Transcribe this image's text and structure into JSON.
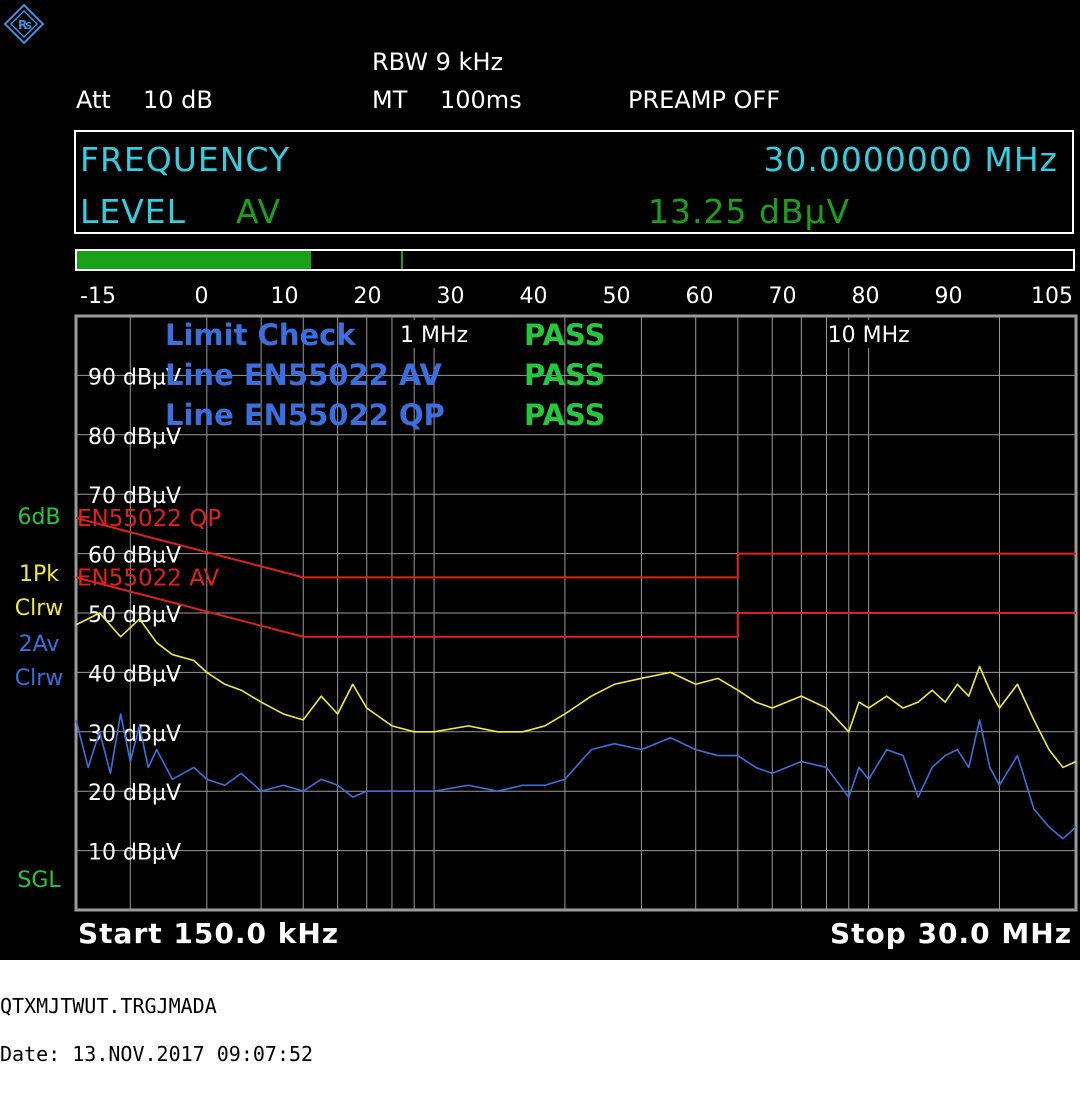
{
  "header": {
    "rbw": "RBW 9 kHz",
    "att_label": "Att",
    "att_value": "10 dB",
    "mt_label": "MT",
    "mt_value": "100ms",
    "preamp": "PREAMP OFF"
  },
  "readout": {
    "frequency_label": "FREQUENCY",
    "frequency_value": "30.0000000 MHz",
    "level_label": "LEVEL",
    "level_detector": "AV",
    "level_value": "13.25 dBµV"
  },
  "bargraph": {
    "scale_labels": [
      "-15",
      "0",
      "10",
      "20",
      "30",
      "40",
      "50",
      "60",
      "70",
      "80",
      "90",
      "105"
    ],
    "range": [
      -15,
      105
    ],
    "fill_value": 13.25,
    "marker_value": 24
  },
  "side_labels": {
    "offset": "6dB",
    "trace1_detector": "1Pk",
    "trace1_mode": "Clrw",
    "trace2_detector": "2Av",
    "trace2_mode": "Clrw",
    "sweep_mode": "SGL"
  },
  "limit_check": {
    "rows": [
      {
        "label": "Limit Check",
        "result": "PASS"
      },
      {
        "label": "Line EN55022 AV",
        "result": "PASS"
      },
      {
        "label": "Line EN55022 QP",
        "result": "PASS"
      }
    ]
  },
  "footer": {
    "start": "Start 150.0 kHz",
    "stop": "Stop 30.0 MHz"
  },
  "print_info": {
    "code": "QTXMJTWUT.TRGJMADA",
    "date": "Date: 13.NOV.2017  09:07:52"
  },
  "colors": {
    "background": "#000000",
    "grid": "#9a9a9a",
    "cyan": "#33cfe0",
    "green": "#1aa11a",
    "bright_green": "#22c93a",
    "blue_text": "#3a6fe0",
    "trace_pk": "#f0ea3c",
    "trace_av": "#3f6fdc",
    "limit": "#e0201c"
  },
  "icons": {
    "logo": "rohde-schwarz-logo-icon"
  },
  "chart_data": {
    "type": "line",
    "title": "",
    "xlabel": "",
    "ylabel": "",
    "x_scale": "log",
    "xlim_mhz": [
      0.15,
      30
    ],
    "ylim": [
      0,
      100
    ],
    "y_tick_labels": [
      "10 dBµV",
      "20 dBµV",
      "30 dBµV",
      "40 dBµV",
      "50 dBµV",
      "60 dBµV",
      "70 dBµV",
      "80 dBµV",
      "90 dBµV"
    ],
    "y_ticks": [
      10,
      20,
      30,
      40,
      50,
      60,
      70,
      80,
      90
    ],
    "x_tick_labels": [
      "1 MHz",
      "10 MHz"
    ],
    "x_ticks_mhz": [
      1,
      10
    ],
    "limit_lines": [
      {
        "name": "EN55022 QP",
        "points": [
          [
            0.15,
            66
          ],
          [
            0.5,
            56
          ],
          [
            5,
            56
          ],
          [
            5,
            60
          ],
          [
            30,
            60
          ]
        ]
      },
      {
        "name": "EN55022 AV",
        "points": [
          [
            0.15,
            56
          ],
          [
            0.5,
            46
          ],
          [
            5,
            46
          ],
          [
            5,
            50
          ],
          [
            30,
            50
          ]
        ]
      }
    ],
    "series": [
      {
        "name": "1Pk Clrw",
        "x": [
          0.15,
          0.17,
          0.19,
          0.21,
          0.23,
          0.25,
          0.28,
          0.3,
          0.33,
          0.36,
          0.4,
          0.45,
          0.5,
          0.55,
          0.6,
          0.65,
          0.7,
          0.8,
          0.9,
          1.0,
          1.2,
          1.4,
          1.6,
          1.8,
          2.0,
          2.3,
          2.6,
          3.0,
          3.5,
          4.0,
          4.5,
          5.0,
          5.5,
          6.0,
          7.0,
          8.0,
          9.0,
          9.5,
          10.0,
          11,
          12,
          13,
          14,
          15,
          16,
          17,
          18,
          19,
          20,
          22,
          24,
          26,
          28,
          30
        ],
        "values": [
          48,
          50,
          46,
          49,
          45,
          43,
          42,
          40,
          38,
          37,
          35,
          33,
          32,
          36,
          33,
          38,
          34,
          31,
          30,
          30,
          31,
          30,
          30,
          31,
          33,
          36,
          38,
          39,
          40,
          38,
          39,
          37,
          35,
          34,
          36,
          34,
          30,
          35,
          34,
          36,
          34,
          35,
          37,
          35,
          38,
          36,
          41,
          37,
          34,
          38,
          32,
          27,
          24,
          25
        ]
      },
      {
        "name": "2Av Clrw",
        "x": [
          0.15,
          0.16,
          0.17,
          0.18,
          0.19,
          0.2,
          0.21,
          0.22,
          0.23,
          0.25,
          0.28,
          0.3,
          0.33,
          0.36,
          0.4,
          0.45,
          0.5,
          0.55,
          0.6,
          0.65,
          0.7,
          0.8,
          0.9,
          1.0,
          1.2,
          1.4,
          1.6,
          1.8,
          2.0,
          2.3,
          2.6,
          3.0,
          3.5,
          4.0,
          4.5,
          5.0,
          5.5,
          6.0,
          7.0,
          8.0,
          9.0,
          9.5,
          10.0,
          11,
          12,
          13,
          14,
          15,
          16,
          17,
          18,
          19,
          20,
          22,
          24,
          26,
          28,
          30
        ],
        "values": [
          32,
          24,
          30,
          23,
          33,
          25,
          31,
          24,
          27,
          22,
          24,
          22,
          21,
          23,
          20,
          21,
          20,
          22,
          21,
          19,
          20,
          20,
          20,
          20,
          21,
          20,
          21,
          21,
          22,
          27,
          28,
          27,
          29,
          27,
          26,
          26,
          24,
          23,
          25,
          24,
          19,
          24,
          22,
          27,
          26,
          19,
          24,
          26,
          27,
          24,
          32,
          24,
          21,
          26,
          17,
          14,
          12,
          14
        ]
      }
    ]
  }
}
